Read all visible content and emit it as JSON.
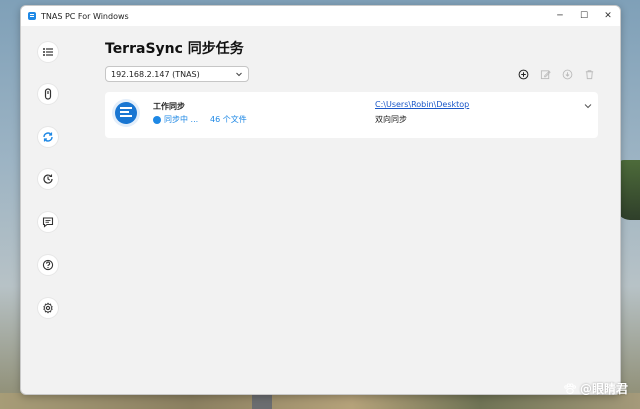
{
  "window": {
    "title": "TNAS PC For Windows",
    "controls": {
      "minimize": "─",
      "maximize": "☐",
      "close": "✕"
    }
  },
  "sidebar": {
    "items": [
      {
        "name": "task-list",
        "icon": "list-icon"
      },
      {
        "name": "backup",
        "icon": "backup-icon"
      },
      {
        "name": "sync",
        "icon": "sync-icon",
        "active": true
      },
      {
        "name": "history",
        "icon": "clock-icon"
      },
      {
        "name": "messages",
        "icon": "message-icon"
      },
      {
        "name": "help",
        "icon": "help-icon"
      },
      {
        "name": "settings",
        "icon": "gear-icon"
      }
    ]
  },
  "main": {
    "title": "TerraSync 同步任务",
    "device_select": {
      "value": "192.168.2.147 (TNAS)"
    },
    "toolbar": [
      {
        "name": "add",
        "icon": "plus-circle-icon"
      },
      {
        "name": "edit",
        "icon": "edit-icon"
      },
      {
        "name": "pause",
        "icon": "pause-circle-icon"
      },
      {
        "name": "delete",
        "icon": "trash-icon"
      }
    ],
    "task": {
      "name": "工作同步",
      "status": "同步中 ...",
      "file_count": "46 个文件",
      "path": "C:\\Users\\Robin\\Desktop",
      "mode": "双向同步"
    }
  },
  "watermark": {
    "text": "@眼睛君"
  },
  "colors": {
    "accent": "#1e88e5",
    "link": "#1a57c8",
    "window_bg": "#f2f2f2",
    "card_bg": "#ffffff"
  }
}
